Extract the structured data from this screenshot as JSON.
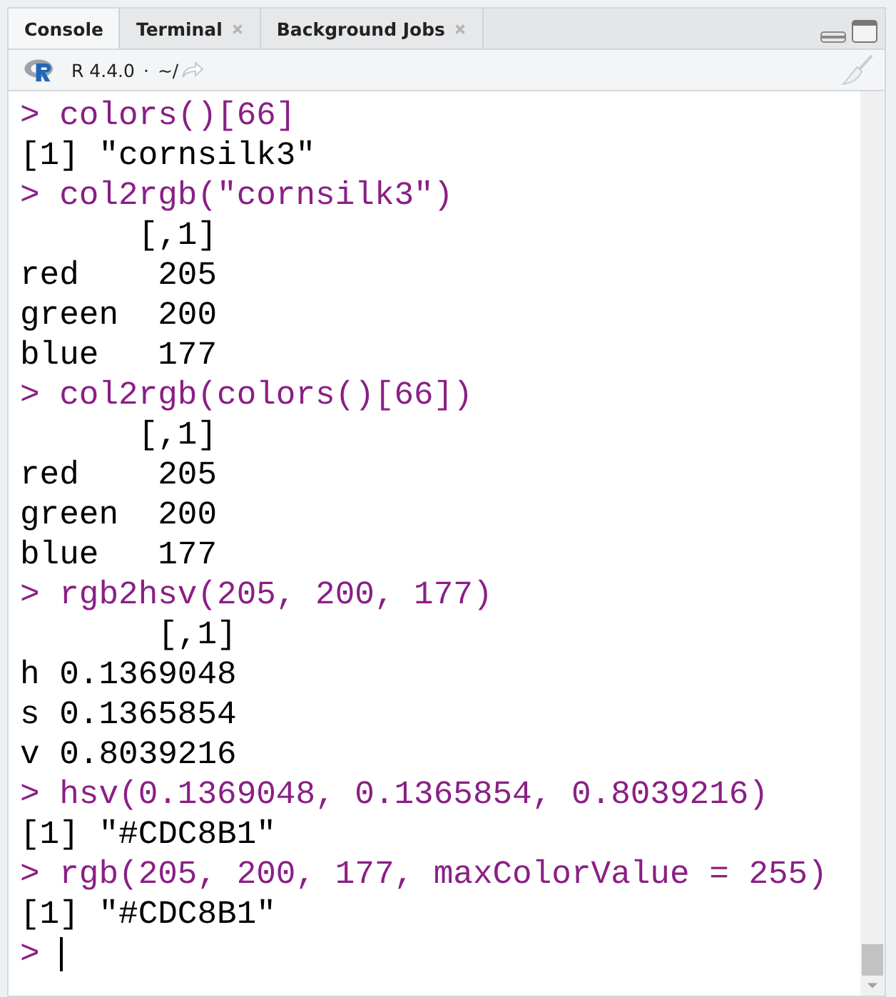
{
  "tabs": [
    {
      "label": "Console",
      "selected": true,
      "closable": false
    },
    {
      "label": "Terminal",
      "selected": false,
      "closable": true
    },
    {
      "label": "Background Jobs",
      "selected": false,
      "closable": true
    }
  ],
  "toolbar": {
    "version": "R 4.4.0",
    "separator": "·",
    "path": "~/"
  },
  "console": {
    "prompt": ">",
    "lines": [
      {
        "kind": "input",
        "text": "colors()[66]"
      },
      {
        "kind": "output",
        "text": "[1] \"cornsilk3\""
      },
      {
        "kind": "input",
        "text": "col2rgb(\"cornsilk3\")"
      },
      {
        "kind": "output",
        "text": "      [,1]"
      },
      {
        "kind": "output",
        "text": "red    205"
      },
      {
        "kind": "output",
        "text": "green  200"
      },
      {
        "kind": "output",
        "text": "blue   177"
      },
      {
        "kind": "input",
        "text": "col2rgb(colors()[66])"
      },
      {
        "kind": "output",
        "text": "      [,1]"
      },
      {
        "kind": "output",
        "text": "red    205"
      },
      {
        "kind": "output",
        "text": "green  200"
      },
      {
        "kind": "output",
        "text": "blue   177"
      },
      {
        "kind": "input",
        "text": "rgb2hsv(205, 200, 177)"
      },
      {
        "kind": "output",
        "text": "       [,1]"
      },
      {
        "kind": "output",
        "text": "h 0.1369048"
      },
      {
        "kind": "output",
        "text": "s 0.1365854"
      },
      {
        "kind": "output",
        "text": "v 0.8039216"
      },
      {
        "kind": "input",
        "text": "hsv(0.1369048, 0.1365854, 0.8039216)"
      },
      {
        "kind": "output",
        "text": "[1] \"#CDC8B1\""
      },
      {
        "kind": "input",
        "text": "rgb(205, 200, 177, maxColorValue = 255)"
      },
      {
        "kind": "output",
        "text": "[1] \"#CDC8B1\""
      },
      {
        "kind": "cursor"
      }
    ]
  }
}
